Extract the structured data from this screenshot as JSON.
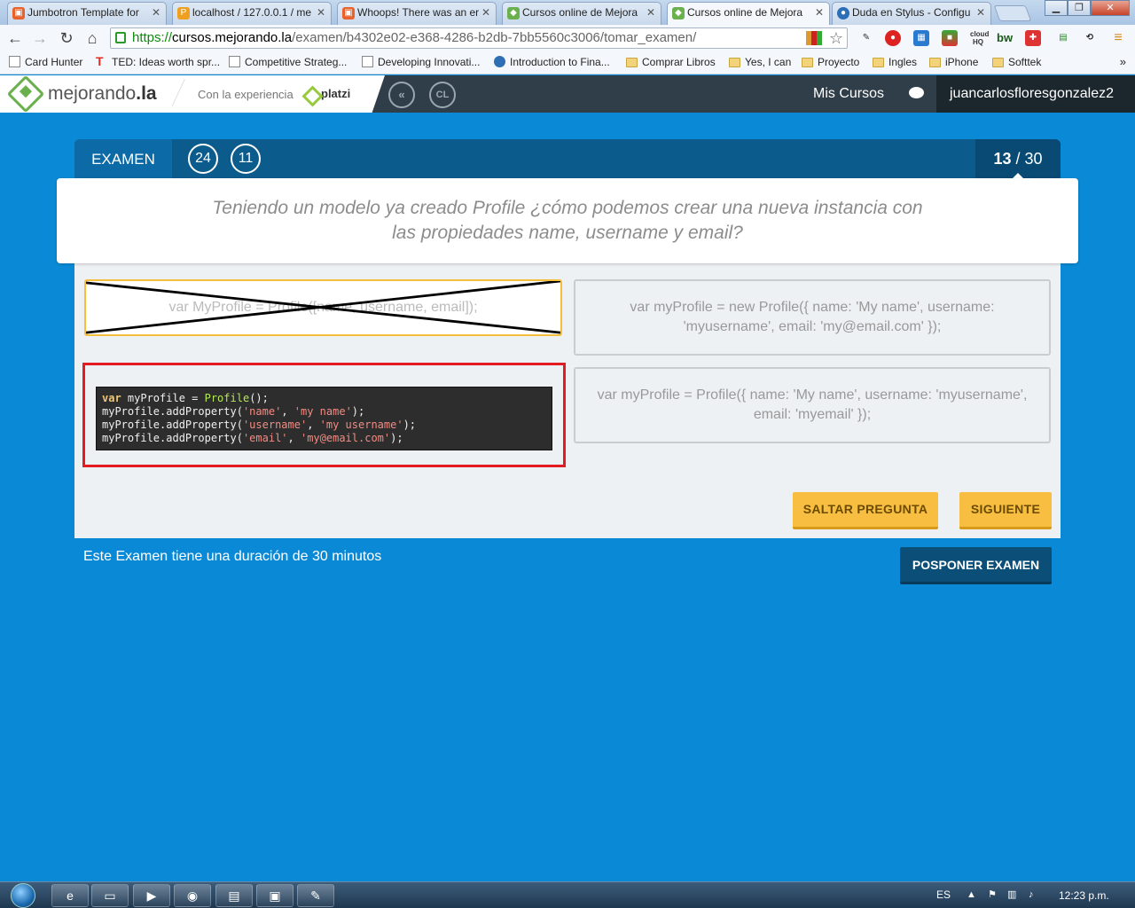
{
  "browser": {
    "tabs": [
      {
        "title": "Jumbotron Template for",
        "icon": "html5-icon",
        "active": false
      },
      {
        "title": "localhost / 127.0.0.1 / me",
        "icon": "phpmyadmin-icon",
        "active": false
      },
      {
        "title": "Whoops! There was an er",
        "icon": "html5-icon",
        "active": false
      },
      {
        "title": "Cursos online de Mejora",
        "icon": "mejorando-icon",
        "active": false
      },
      {
        "title": "Cursos online de Mejora",
        "icon": "mejorando-icon",
        "active": true
      },
      {
        "title": "Duda en Stylus - Configu",
        "icon": "globe-icon",
        "active": false
      }
    ],
    "url": {
      "scheme": "https://",
      "host": "cursos.mejorando.la",
      "path": "/examen/b4302e02-e368-4286-b2db-7bb5560c3006/tomar_examen/"
    },
    "bookmarks": [
      {
        "label": "Card Hunter",
        "icon": "page"
      },
      {
        "label": "TED: Ideas worth spr...",
        "icon": "ted"
      },
      {
        "label": "Competitive Strateg...",
        "icon": "page"
      },
      {
        "label": "Developing Innovati...",
        "icon": "page"
      },
      {
        "label": "Introduction to Fina...",
        "icon": "circle"
      },
      {
        "label": "Comprar Libros",
        "icon": "folder"
      },
      {
        "label": "Yes, I can",
        "icon": "folder"
      },
      {
        "label": "Proyecto",
        "icon": "folder"
      },
      {
        "label": "Ingles",
        "icon": "folder"
      },
      {
        "label": "iPhone",
        "icon": "folder"
      },
      {
        "label": "Softtek",
        "icon": "folder"
      }
    ],
    "bookmarks_more": "»"
  },
  "site": {
    "logo_text": "mejorando",
    "logo_suffix": ".la",
    "partner_prefix": "Con la experiencia",
    "partner_name": "platzi",
    "circle_1": "«",
    "circle_2": "CL",
    "nav_courses": "Mis Cursos",
    "username": "juancarlosfloresgonzalez2"
  },
  "exam": {
    "label": "EXAMEN",
    "timer_minutes": "24",
    "timer_seconds": "11",
    "current": "13",
    "total": "/ 30",
    "question": "Teniendo un modelo ya creado Profile ¿cómo podemos crear una nueva instancia con las propiedades name, username y email?",
    "options": [
      {
        "text": "var MyProfile = Profile([name, username, email]);",
        "state": "discarded"
      },
      {
        "text": "var myProfile = new Profile({ name: 'My name', username: 'myusername', email: 'my@email.com' });",
        "state": "normal"
      },
      {
        "text": "code",
        "state": "highlighted"
      },
      {
        "text": "var myProfile = Profile({ name: 'My name', username: 'myusername', email: 'myemail' });",
        "state": "normal"
      }
    ],
    "code_lines": {
      "l1_kw": "var",
      "l1_rest": " myProfile = ",
      "l1_fn": "Profile",
      "l1_end": "();",
      "l2_a": "myProfile.addProperty(",
      "l2_s1": "'name'",
      "l2_c": ", ",
      "l2_s2": "'my name'",
      "l2_e": ");",
      "l3_a": "myProfile.addProperty(",
      "l3_s1": "'username'",
      "l3_c": ", ",
      "l3_s2": "'my username'",
      "l3_e": ");",
      "l4_a": "myProfile.addProperty(",
      "l4_s1": "'email'",
      "l4_c": ", ",
      "l4_s2": "'my@email.com'",
      "l4_e": ");"
    },
    "skip_label": "SALTAR PREGUNTA",
    "next_label": "SIGUIENTE",
    "duration_text": "Este Examen tiene una duración de 30 minutos",
    "postpone_label": "POSPONER EXAMEN"
  },
  "taskbar": {
    "language": "ES",
    "clock": "12:23 p.m."
  },
  "colors": {
    "page_bg": "#0a8ad6",
    "accent_yellow": "#f8be42",
    "highlight_red": "#e31b23",
    "header_dark": "#2f3e48"
  }
}
